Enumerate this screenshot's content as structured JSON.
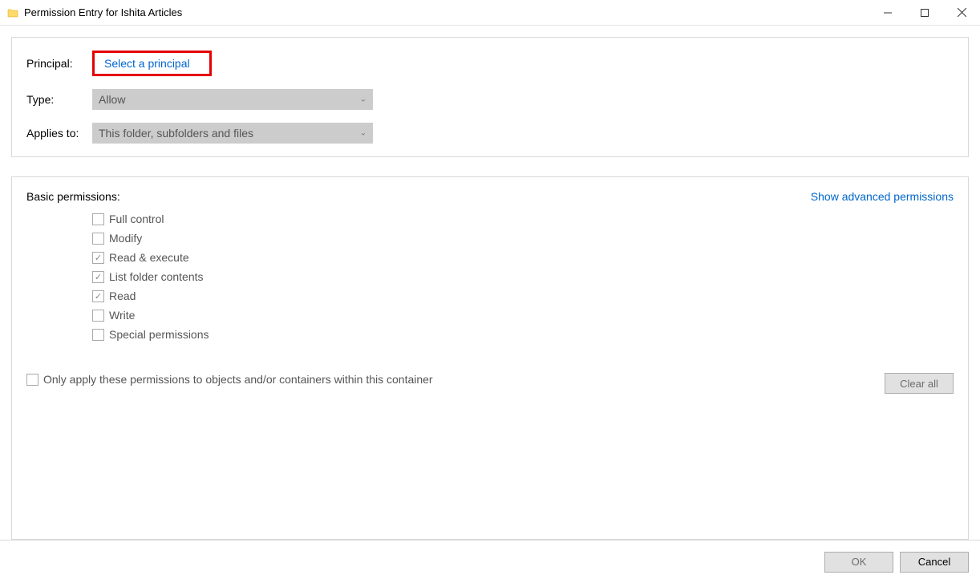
{
  "window": {
    "title": "Permission Entry for Ishita Articles"
  },
  "top": {
    "principal_label": "Principal:",
    "principal_link": "Select a principal",
    "type_label": "Type:",
    "type_value": "Allow",
    "applies_label": "Applies to:",
    "applies_value": "This folder, subfolders and files"
  },
  "permissions": {
    "title": "Basic permissions:",
    "advanced_link": "Show advanced permissions",
    "items": [
      {
        "label": "Full control",
        "checked": false
      },
      {
        "label": "Modify",
        "checked": false
      },
      {
        "label": "Read & execute",
        "checked": true
      },
      {
        "label": "List folder contents",
        "checked": true
      },
      {
        "label": "Read",
        "checked": true
      },
      {
        "label": "Write",
        "checked": false
      },
      {
        "label": "Special permissions",
        "checked": false
      }
    ],
    "only_apply_label": "Only apply these permissions to objects and/or containers within this container",
    "only_apply_checked": false,
    "clear_all": "Clear all"
  },
  "footer": {
    "ok": "OK",
    "cancel": "Cancel"
  }
}
